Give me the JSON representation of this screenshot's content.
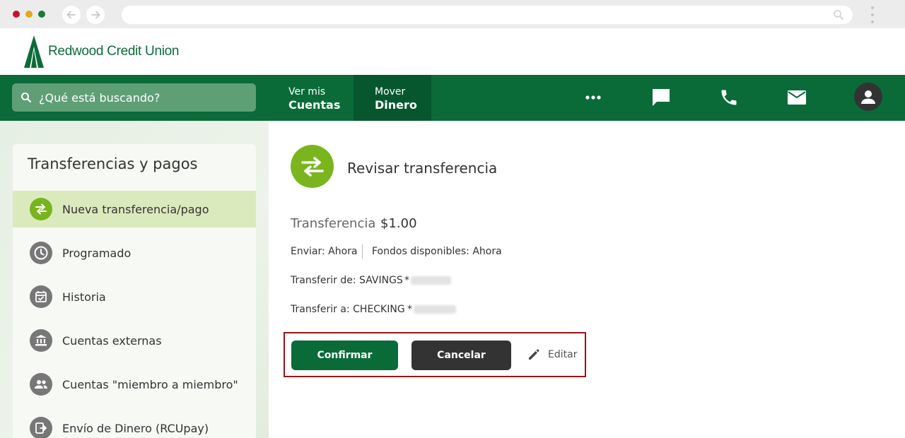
{
  "brand": {
    "name": "Redwood Credit Union",
    "primary_color": "#0a6b39",
    "accent_color": "#7ab51d"
  },
  "nav": {
    "search_placeholder": "¿Qué está buscando?",
    "items": [
      {
        "small": "Ver mis",
        "big": "Cuentas"
      },
      {
        "small": "Mover",
        "big": "Dinero"
      }
    ],
    "icons": [
      "more-icon",
      "chat-icon",
      "phone-icon",
      "mail-icon",
      "user-icon"
    ]
  },
  "sidebar": {
    "title": "Transferencias y pagos",
    "items": [
      {
        "label": "Nueva transferencia/pago",
        "icon": "transfer-icon",
        "active": true
      },
      {
        "label": "Programado",
        "icon": "clock-icon"
      },
      {
        "label": "Historia",
        "icon": "calendar-check-icon"
      },
      {
        "label": "Cuentas externas",
        "icon": "bank-icon"
      },
      {
        "label": "Cuentas \"miembro a miembro\"",
        "icon": "people-icon"
      },
      {
        "label": "Envío de Dinero (RCUpay)",
        "icon": "send-money-icon"
      }
    ]
  },
  "review": {
    "title": "Revisar transferencia",
    "transfer_label": "Transferencia",
    "amount": "$1.00",
    "send": "Enviar: Ahora",
    "funds": "Fondos disponibles: Ahora",
    "from": "Transferir de: SAVINGS",
    "from_mask": "*",
    "to": "Transferir a: CHECKING",
    "to_mask": "*"
  },
  "actions": {
    "confirm": "Confirmar",
    "cancel": "Cancelar",
    "edit": "Editar"
  }
}
